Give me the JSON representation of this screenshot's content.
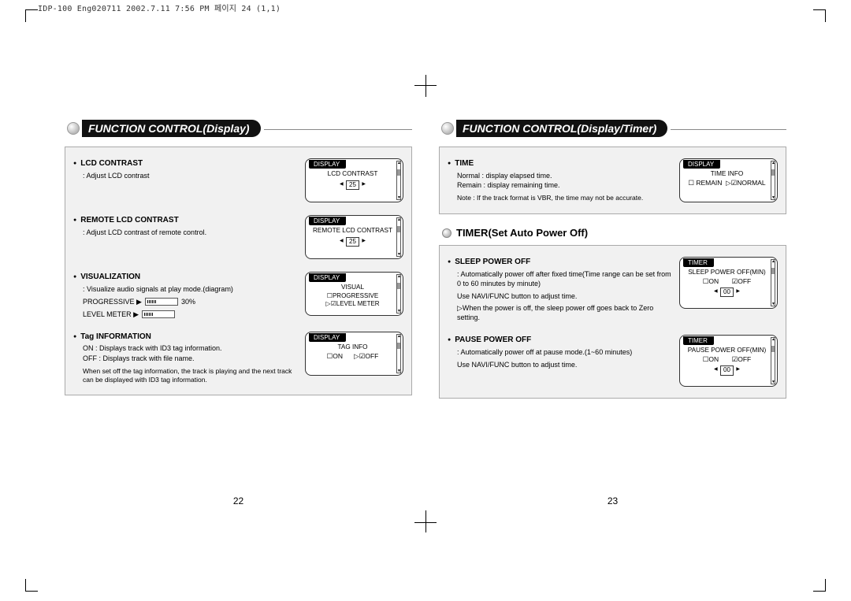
{
  "header": "IDP-100 Eng020711  2002.7.11 7:56 PM  페이지 24 (1,1)",
  "left": {
    "title": "FUNCTION CONTROL(Display)",
    "pgnum": "22",
    "sections": [
      {
        "title": "LCD CONTRAST",
        "desc": ": Adjust LCD contrast",
        "lcdTab": "DISPLAY",
        "lcdLine1": "LCD CONTRAST",
        "lcdValue": "25"
      },
      {
        "title": "REMOTE LCD CONTRAST",
        "desc": ": Adjust LCD contrast of remote control.",
        "lcdTab": "DISPLAY",
        "lcdLine1": "REMOTE LCD CONTRAST",
        "lcdValue": "25"
      },
      {
        "title": "VISUALIZATION",
        "desc": ": Visualize audio signals at play mode.(diagram)",
        "progLabel": "PROGRESSIVE ▶",
        "progPct": "30%",
        "levelLabel": "LEVEL METER ▶",
        "lcdTab": "DISPLAY",
        "lcdLine1": "VISUAL",
        "lcdOpt1": "☐PROGRESSIVE",
        "lcdOpt2": "▷☑LEVEL METER"
      },
      {
        "title": "Tag INFORMATION",
        "desc": "ON : Displays track with ID3 tag information.\nOFF : Displays track with file name.",
        "note": "When set off the tag information, the track is playing and the next track can be displayed with ID3 tag information.",
        "lcdTab": "DISPLAY",
        "lcdLine1": "TAG INFO",
        "lcdOnOff": "☐ON      ▷☑OFF"
      }
    ]
  },
  "right": {
    "title": "FUNCTION CONTROL(Display/Timer)",
    "pgnum": "23",
    "box1": {
      "title": "TIME",
      "l1": "Normal : display elapsed time.",
      "l2": "Remain : display remaining time.",
      "note": "Note : If the track format is VBR, the time may not be accurate.",
      "lcdTab": "DISPLAY",
      "lcdLine1": "TIME INFO",
      "lcdOnOff": "☐ REMAIN  ▷☑NORMAL"
    },
    "subheading": "TIMER(Set Auto Power Off)",
    "box2a": {
      "title": "SLEEP POWER OFF",
      "desc": ": Automatically power off after fixed time(Time range can be set from 0 to 60 minutes by minute)",
      "use": "Use NAVI/FUNC button to adjust time.",
      "use2": "▷When the power is off, the sleep power off goes back to Zero setting.",
      "lcdTab": "TIMER",
      "lcdLine1": "SLEEP POWER OFF(MIN)",
      "lcdOnOff": "☐ON       ☑OFF",
      "lcdValue": "00"
    },
    "box2b": {
      "title": "PAUSE POWER OFF",
      "desc": ": Automatically power off at pause mode.(1~60 minutes)",
      "use": "Use NAVI/FUNC button to adjust time.",
      "lcdTab": "TIMER",
      "lcdLine1": "PAUSE POWER OFF(MIN)",
      "lcdOnOff": "☐ON       ☑OFF",
      "lcdValue": "00"
    }
  }
}
